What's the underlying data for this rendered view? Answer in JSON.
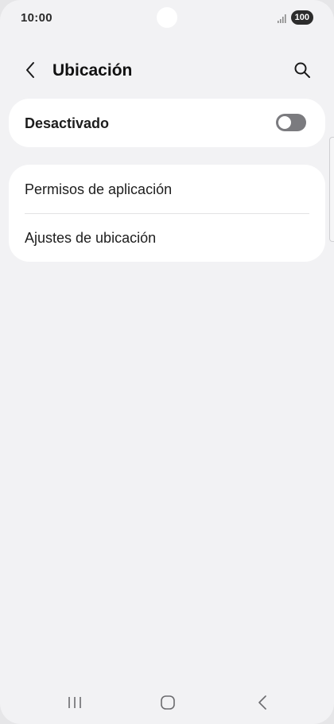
{
  "status_bar": {
    "time": "10:00",
    "battery": "100",
    "icons": [
      "signal-icon",
      "battery-icon"
    ]
  },
  "header": {
    "title": "Ubicación",
    "back_icon": "back-arrow-icon",
    "search_icon": "search-icon"
  },
  "location_toggle": {
    "label": "Desactivado",
    "state": "off"
  },
  "settings_list": {
    "items": [
      {
        "label": "Permisos de aplicación"
      },
      {
        "label": "Ajustes de ubicación"
      }
    ]
  },
  "nav_bar": {
    "icons": [
      "recents-icon",
      "home-icon",
      "back-icon"
    ]
  },
  "colors": {
    "background": "#f2f2f4",
    "card": "#ffffff",
    "switch_off": "#7b7b7f",
    "text_primary": "#1d1d1d"
  }
}
